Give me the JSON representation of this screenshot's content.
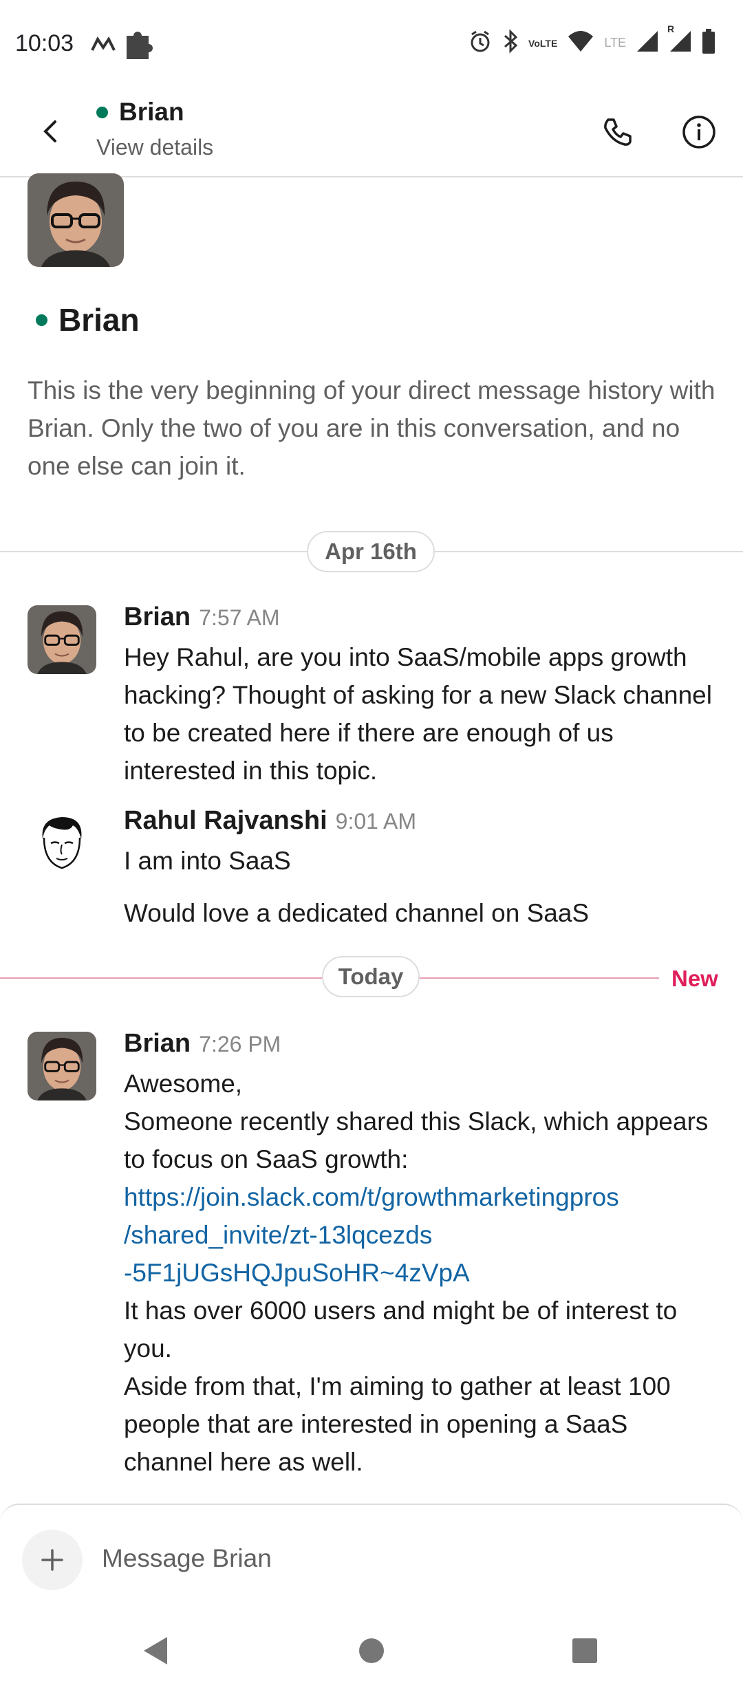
{
  "status_bar": {
    "time": "10:03",
    "left_icons": [
      "m-app-icon",
      "puzzle-icon"
    ],
    "right_icons": [
      "alarm-icon",
      "bluetooth-icon",
      "volte-icon",
      "wifi-icon",
      "signal-icon",
      "signal-roaming-icon",
      "battery-icon"
    ],
    "volte_text": "VoLTE",
    "lte_text": "LTE",
    "roaming_text": "R"
  },
  "header": {
    "name": "Brian",
    "subtitle": "View details",
    "presence_color": "#007a5a"
  },
  "intro": {
    "name": "Brian",
    "text": "This is the very beginning of your direct message history with Brian. Only the two of you are in this conversation, and no one else can join it."
  },
  "dividers": {
    "date1": "Apr 16th",
    "date2": "Today",
    "new_label": "New"
  },
  "messages": [
    {
      "author": "Brian",
      "time": "7:57 AM",
      "text": "Hey Rahul, are you into SaaS/mobile apps growth hacking? Thought of asking for a new Slack channel to be created here if there are enough of us interested in this topic."
    },
    {
      "author": "Rahul Rajvanshi",
      "time": "9:01 AM",
      "text": "I am into SaaS",
      "text2": "Would love a dedicated channel on SaaS"
    },
    {
      "author": "Brian",
      "time": "7:26 PM",
      "line1": "Awesome,",
      "line2": "Someone recently shared this Slack, which appears to focus on SaaS growth:",
      "link": "https://join.slack.com/t/growthmarketingpros/shared_invite/zt-13lqcezds-5F1jUGsHQJpuSoHR~4zVpA",
      "link_line1": "https://join.slack.com/t/growthmarketingpros",
      "link_line2": "/shared_invite/zt-13lqcezds",
      "link_line3": "-5F1jUGsHQJpuSoHR~4zVpA",
      "line3": "It has over 6000 users and might be of interest to you.",
      "line4": "Aside from that, I'm aiming to gather at least 100 people that are interested in opening a SaaS channel here as well."
    }
  ],
  "composer": {
    "placeholder": "Message Brian"
  },
  "colors": {
    "link": "#1264a3",
    "new": "#e01e5a",
    "presence": "#007a5a"
  }
}
